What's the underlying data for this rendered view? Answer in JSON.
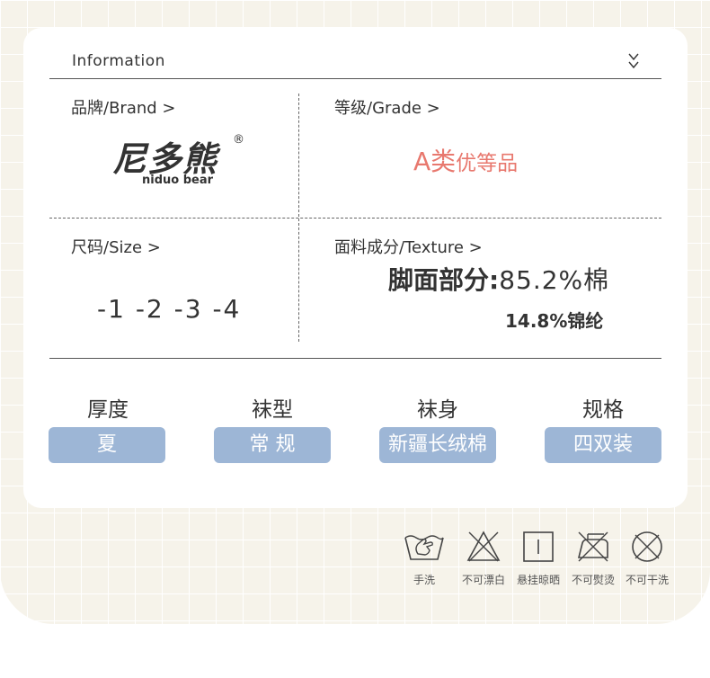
{
  "header": {
    "title": "Information"
  },
  "brand": {
    "label": "品牌/Brand >",
    "logo_text": "尼多熊",
    "logo_sub": "niduo bear",
    "logo_mark": "®"
  },
  "grade": {
    "label": "等级/Grade >",
    "value_big": "A类",
    "value_small": "优等品",
    "color": "#e8786e"
  },
  "size": {
    "label": "尺码/Size >",
    "values": "-1 -2 -3 -4"
  },
  "texture": {
    "label": "面料成分/Texture >",
    "line1_prefix": "脚面部分:",
    "line1_value": "85.2%棉",
    "line2": "14.8%锦纶"
  },
  "attributes": [
    {
      "title": "厚度",
      "value": "夏"
    },
    {
      "title": "袜型",
      "value": "常 规"
    },
    {
      "title": "袜身",
      "value": "新疆长绒棉"
    },
    {
      "title": "规格",
      "value": "四双装"
    }
  ],
  "pill_color": "#9db6d6",
  "care": [
    {
      "icon": "hand-wash-icon",
      "label": "手洗"
    },
    {
      "icon": "no-bleach-icon",
      "label": "不可漂白"
    },
    {
      "icon": "hang-dry-icon",
      "label": "悬挂晾晒"
    },
    {
      "icon": "no-iron-icon",
      "label": "不可熨烫"
    },
    {
      "icon": "no-dry-clean-icon",
      "label": "不可干洗"
    }
  ]
}
